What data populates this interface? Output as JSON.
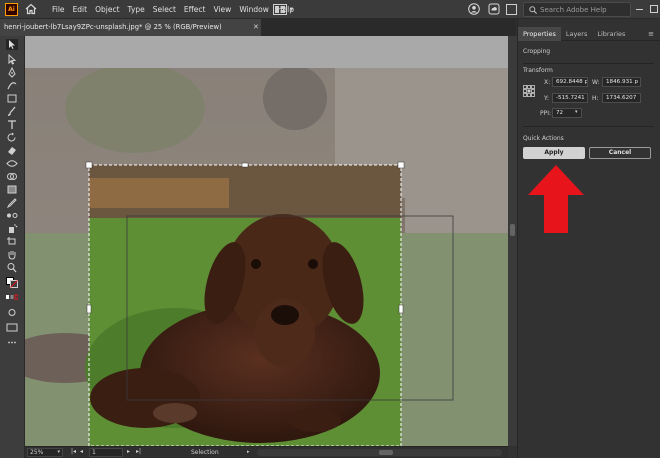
{
  "app": {
    "logo_text": "Ai"
  },
  "menu": [
    "File",
    "Edit",
    "Object",
    "Type",
    "Select",
    "Effect",
    "View",
    "Window",
    "Help"
  ],
  "search": {
    "placeholder": "Search Adobe Help"
  },
  "document": {
    "tab_title": "henri-joubert-lb7Lsay9ZPc-unsplash.jpg* @ 25 % (RGB/Preview)"
  },
  "status": {
    "zoom": "25%",
    "artboard": "1",
    "tool": "Selection"
  },
  "panel": {
    "tabs": [
      "Properties",
      "Layers",
      "Libraries"
    ],
    "section_cropping": "Cropping",
    "section_transform": "Transform",
    "transform": {
      "x_label": "X:",
      "x_value": "692.8448 p",
      "y_label": "Y:",
      "y_value": "-515.7241 p",
      "w_label": "W:",
      "w_value": "1846.931 p",
      "h_label": "H:",
      "h_value": "1734.6207",
      "ppi_label": "PPI:",
      "ppi_value": "72"
    },
    "section_quick": "Quick Actions",
    "apply_label": "Apply",
    "cancel_label": "Cancel"
  },
  "colors": {
    "accent_arrow": "#e8141b",
    "app_logo": "#ff9a00",
    "panel_bg": "#323232"
  }
}
